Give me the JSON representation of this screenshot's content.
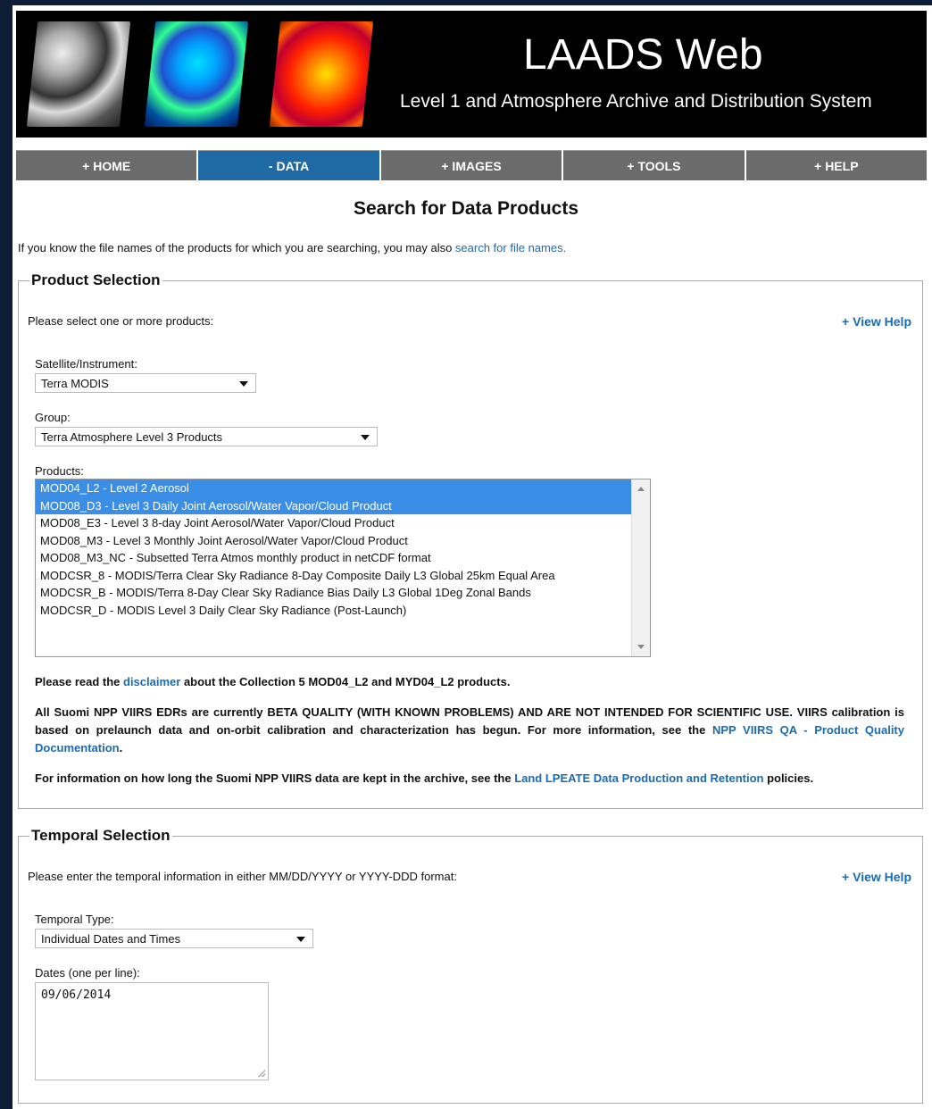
{
  "banner": {
    "title": "LAADS Web",
    "subtitle": "Level 1 and Atmosphere Archive and Distribution System"
  },
  "nav": {
    "home": "+ HOME",
    "data": "- DATA",
    "images": "+ IMAGES",
    "tools": "+ TOOLS",
    "help": "+ HELP"
  },
  "page_title": "Search for Data Products",
  "intro": {
    "text": "If you know the file names of the products for which you are searching, you may also ",
    "link": "search for file names."
  },
  "product_selection": {
    "legend": "Product Selection",
    "instruction": "Please select one or more products:",
    "view_help": "+ View Help",
    "satellite_label": "Satellite/Instrument:",
    "satellite_value": "Terra MODIS",
    "group_label": "Group:",
    "group_value": "Terra Atmosphere Level 3 Products",
    "products_label": "Products:",
    "products": [
      {
        "label": "MOD04_L2 - Level 2 Aerosol",
        "selected": true
      },
      {
        "label": "MOD08_D3 - Level 3 Daily Joint Aerosol/Water Vapor/Cloud Product",
        "selected": true
      },
      {
        "label": "MOD08_E3 - Level 3 8-day Joint Aerosol/Water Vapor/Cloud Product",
        "selected": false
      },
      {
        "label": "MOD08_M3 - Level 3 Monthly Joint Aerosol/Water Vapor/Cloud Product",
        "selected": false
      },
      {
        "label": "MOD08_M3_NC - Subsetted Terra Atmos monthly product in netCDF format",
        "selected": false
      },
      {
        "label": "MODCSR_8 - MODIS/Terra Clear Sky Radiance 8-Day Composite Daily L3 Global 25km Equal Area",
        "selected": false
      },
      {
        "label": "MODCSR_B - MODIS/Terra 8-Day Clear Sky Radiance Bias Daily L3 Global 1Deg Zonal Bands",
        "selected": false
      },
      {
        "label": "MODCSR_D - MODIS Level 3 Daily Clear Sky Radiance (Post-Launch)",
        "selected": false
      }
    ],
    "disclaimer": {
      "pre": "Please read the ",
      "link": "disclaimer",
      "post": " about the Collection 5 MOD04_L2 and MYD04_L2 products."
    },
    "viirs_note": {
      "pre": "All Suomi NPP VIIRS EDRs are currently BETA QUALITY (WITH KNOWN PROBLEMS) AND ARE NOT INTENDED FOR SCIENTIFIC USE. VIIRS calibration is based on prelaunch data and on-orbit calibration and characterization has begun. For more information, see the ",
      "link": "NPP VIIRS QA - Product Quality Documentation",
      "post": "."
    },
    "retention_note": {
      "pre": "For information on how long the Suomi NPP VIIRS data are kept in the archive, see the ",
      "link": "Land LPEATE Data Production and Retention",
      "post": " policies."
    }
  },
  "temporal_selection": {
    "legend": "Temporal Selection",
    "instruction": "Please enter the temporal information in either MM/DD/YYYY or YYYY-DDD format:",
    "view_help": "+ View Help",
    "type_label": "Temporal Type:",
    "type_value": "Individual Dates and Times",
    "dates_label": "Dates (one per line):",
    "dates_value": "09/06/2014"
  },
  "colors": {
    "nav_bg": "#6b6b6b",
    "nav_active": "#1f6aa5",
    "link": "#1a6bb5",
    "selection": "#3b8ee6",
    "page_bg": "#0d1d35"
  }
}
